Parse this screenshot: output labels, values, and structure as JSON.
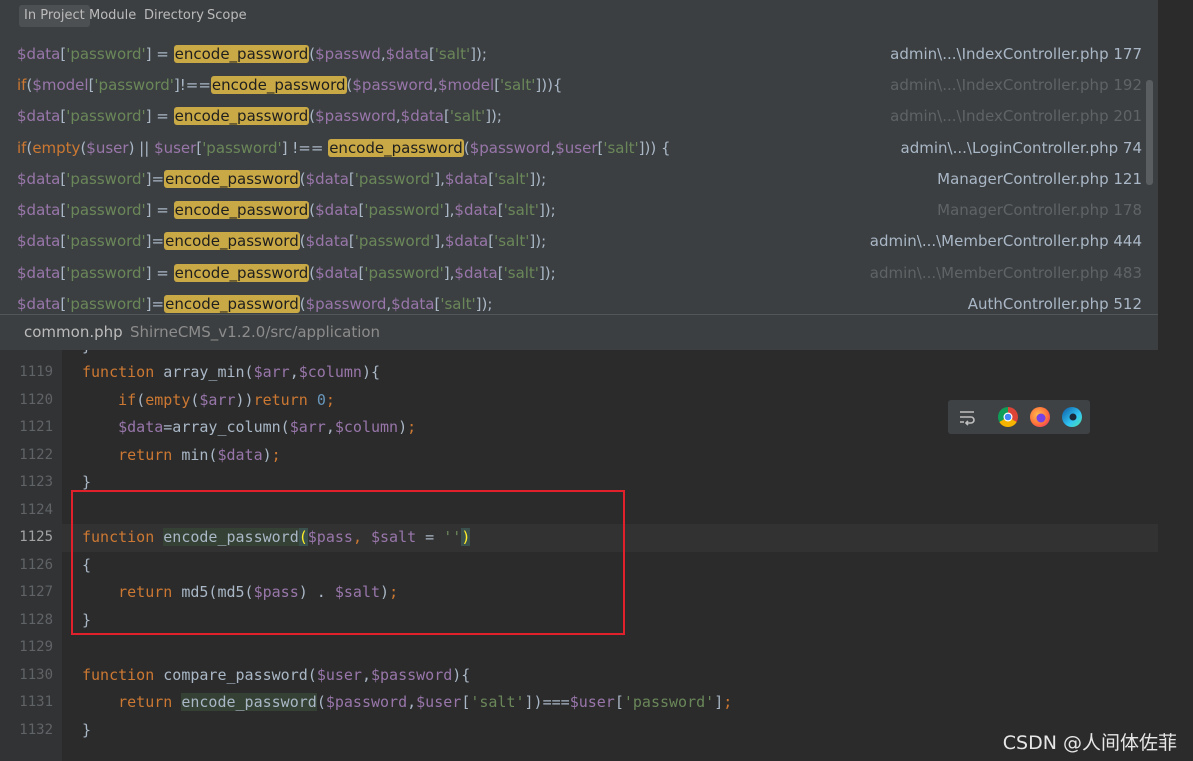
{
  "scope_tabs": [
    {
      "label": "In Project"
    },
    {
      "label": "Module"
    },
    {
      "label": "Directory"
    },
    {
      "label": "Scope"
    }
  ],
  "results": [
    {
      "location": "admin\\...\\IndexController.php 177",
      "dim": false
    },
    {
      "location": "admin\\...\\IndexController.php 192",
      "dim": true
    },
    {
      "location": "admin\\...\\IndexController.php 201",
      "dim": true
    },
    {
      "location": "admin\\...\\LoginController.php 74",
      "dim": false
    },
    {
      "location": "ManagerController.php 121",
      "dim": false
    },
    {
      "location": "ManagerController.php 178",
      "dim": true
    },
    {
      "location": "admin\\...\\MemberController.php 444",
      "dim": false
    },
    {
      "location": "admin\\...\\MemberController.php 483",
      "dim": true
    },
    {
      "location": "AuthController.php 512",
      "dim": false
    }
  ],
  "file_header": {
    "name": "common.php",
    "path": "ShirneCMS_v1.2.0/src/application"
  },
  "line_numbers": [
    "1119",
    "1120",
    "1121",
    "1122",
    "1123",
    "1124",
    "1125",
    "1126",
    "1127",
    "1128",
    "1129",
    "1130",
    "1131",
    "1132"
  ],
  "current_line": "1125",
  "browser_icons": [
    "word-wrap-icon",
    "chrome-icon",
    "firefox-icon",
    "edge-icon"
  ],
  "watermark": "CSDN @人间体佐菲"
}
